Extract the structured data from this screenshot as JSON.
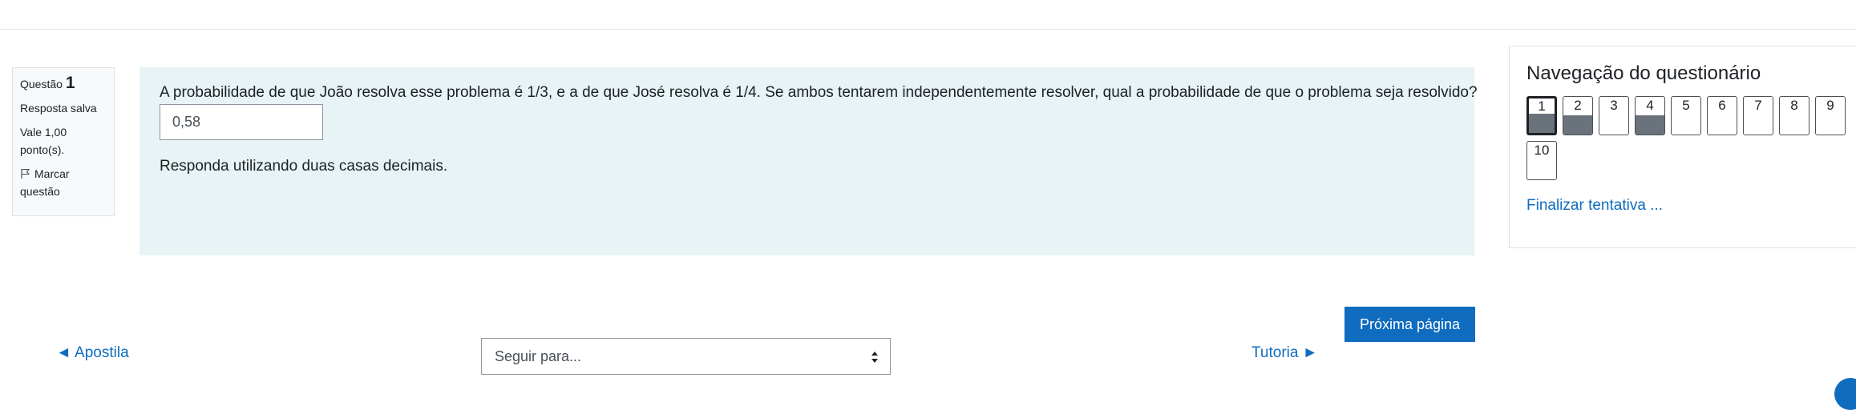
{
  "question_info": {
    "label": "Questão",
    "number": "1",
    "state": "Resposta salva",
    "grade": "Vale 1,00 ponto(s).",
    "flag_label": "Marcar questão"
  },
  "question": {
    "text": "A probabilidade de que João resolva esse problema é 1/3, e a de que José resolva é 1/4. Se ambos tentarem independentemente resolver, qual a probabilidade de que o problema seja resolvido?",
    "answer_value": "0,58",
    "hint": "Responda utilizando duas casas decimais."
  },
  "actions": {
    "next_page": "Próxima página"
  },
  "activity_nav": {
    "prev_label": "◄ Apostila",
    "jump_placeholder": "Seguir para...",
    "next_label": "Tutoria ►"
  },
  "quiz_nav": {
    "title": "Navegação do questionário",
    "buttons": [
      {
        "label": "1",
        "answered": true,
        "current": true
      },
      {
        "label": "2",
        "answered": true,
        "current": false
      },
      {
        "label": "3",
        "answered": false,
        "current": false
      },
      {
        "label": "4",
        "answered": true,
        "current": false
      },
      {
        "label": "5",
        "answered": false,
        "current": false
      },
      {
        "label": "6",
        "answered": false,
        "current": false
      },
      {
        "label": "7",
        "answered": false,
        "current": false
      },
      {
        "label": "8",
        "answered": false,
        "current": false
      },
      {
        "label": "9",
        "answered": false,
        "current": false
      },
      {
        "label": "10",
        "answered": false,
        "current": false
      }
    ],
    "finish_label": "Finalizar tentativa ..."
  },
  "colors": {
    "brand": "#0f6cbf",
    "formulation_bg": "#e7f3f5",
    "answered_fill": "#6a737b"
  }
}
